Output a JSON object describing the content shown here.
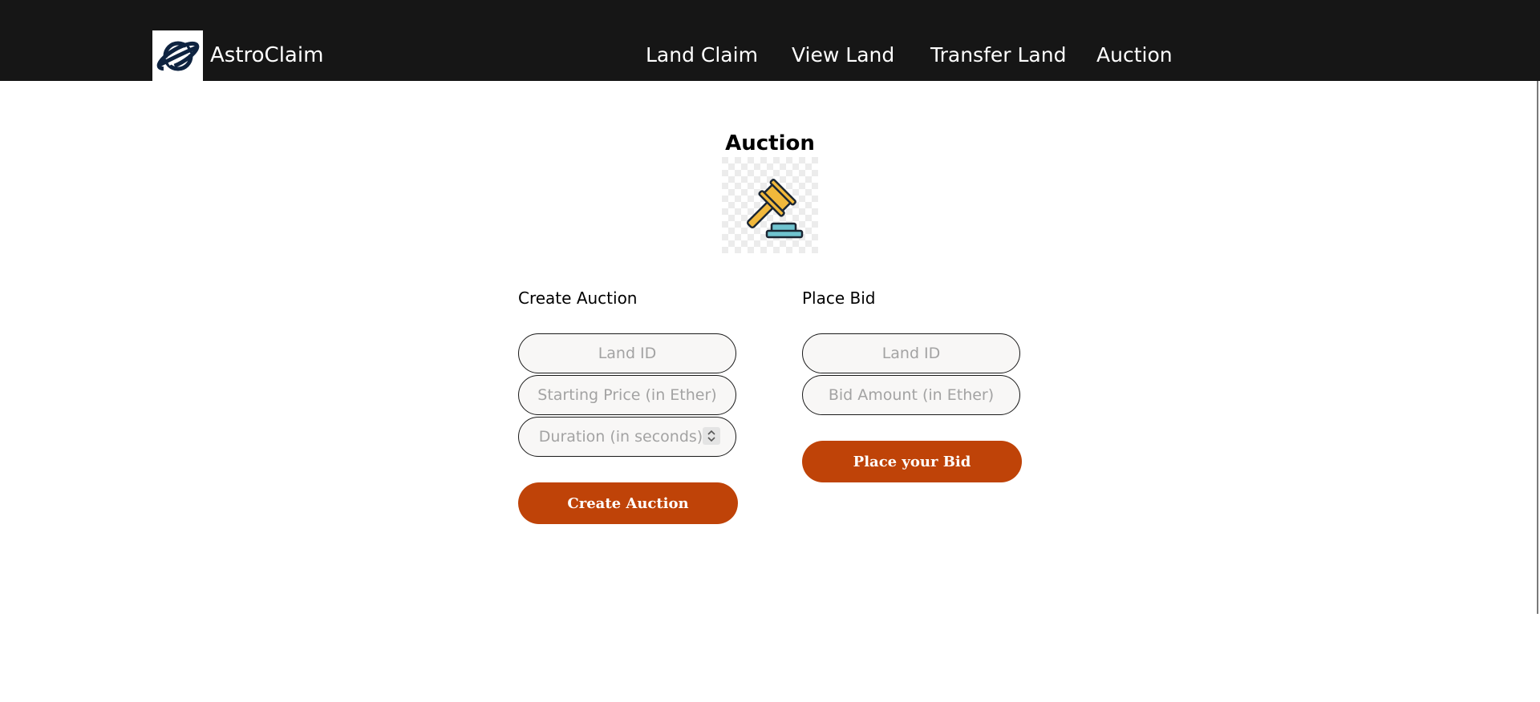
{
  "app": {
    "brand": "AstroClaim",
    "logo_icon": "planet-icon"
  },
  "nav": {
    "items": [
      {
        "label": "Land Claim"
      },
      {
        "label": "View Land"
      },
      {
        "label": "Transfer Land"
      },
      {
        "label": "Auction"
      }
    ]
  },
  "main": {
    "title": "Auction",
    "illustration": "gavel-icon"
  },
  "create_auction": {
    "heading": "Create Auction",
    "land_id": {
      "value": "",
      "placeholder": "Land ID"
    },
    "starting_price": {
      "value": "",
      "placeholder": "Starting Price (in Ether)"
    },
    "duration": {
      "value": "",
      "placeholder": "Duration (in seconds)"
    },
    "submit_label": "Create Auction"
  },
  "place_bid": {
    "heading": "Place Bid",
    "land_id": {
      "value": "",
      "placeholder": "Land ID"
    },
    "bid_amount": {
      "value": "",
      "placeholder": "Bid Amount (in Ether)"
    },
    "submit_label": "Place your Bid"
  },
  "colors": {
    "navbar": "#161616",
    "accent_button": "#bf4308",
    "input_background": "#f8f7f6",
    "gavel_yellow": "#f1b83b",
    "gavel_base": "#6fc3cf"
  }
}
